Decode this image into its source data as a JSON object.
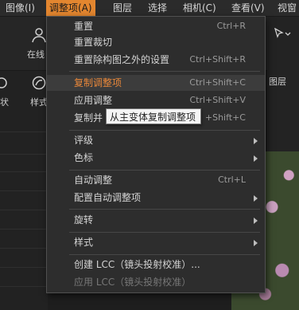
{
  "menubar": {
    "items": [
      "图像(I)",
      "调整项(A)",
      "图层",
      "选择",
      "相机(C)",
      "查看(V)",
      "视窗"
    ]
  },
  "background": {
    "label_online": "在线",
    "label_left_fragment": "状",
    "label_style": "样式",
    "label_layers": "图层"
  },
  "menu": {
    "items": [
      {
        "label": "重置",
        "shortcut": "Ctrl+R"
      },
      {
        "label": "重置裁切",
        "shortcut": ""
      },
      {
        "label": "重置除构图之外的设置",
        "shortcut": "Ctrl+Shift+R"
      },
      {
        "label": "复制调整项",
        "shortcut": "Ctrl+Shift+C"
      },
      {
        "label": "应用调整",
        "shortcut": "Ctrl+Shift+V"
      },
      {
        "label": "复制并",
        "shortcut": "+Shift+C"
      },
      {
        "label": "评级",
        "shortcut": ""
      },
      {
        "label": "色标",
        "shortcut": ""
      },
      {
        "label": "自动调整",
        "shortcut": "Ctrl+L"
      },
      {
        "label": "配置自动调整项",
        "shortcut": ""
      },
      {
        "label": "旋转",
        "shortcut": ""
      },
      {
        "label": "样式",
        "shortcut": ""
      },
      {
        "label": "创建 LCC（镜头投射校准）...",
        "shortcut": ""
      },
      {
        "label": "应用 LCC（镜头投射校准）",
        "shortcut": ""
      }
    ]
  },
  "tooltip": {
    "text": "从主变体复制调整项"
  },
  "colors": {
    "accent": "#e3862f",
    "menu_bg": "#2d2d2d",
    "app_bg": "#1e1e1e"
  }
}
